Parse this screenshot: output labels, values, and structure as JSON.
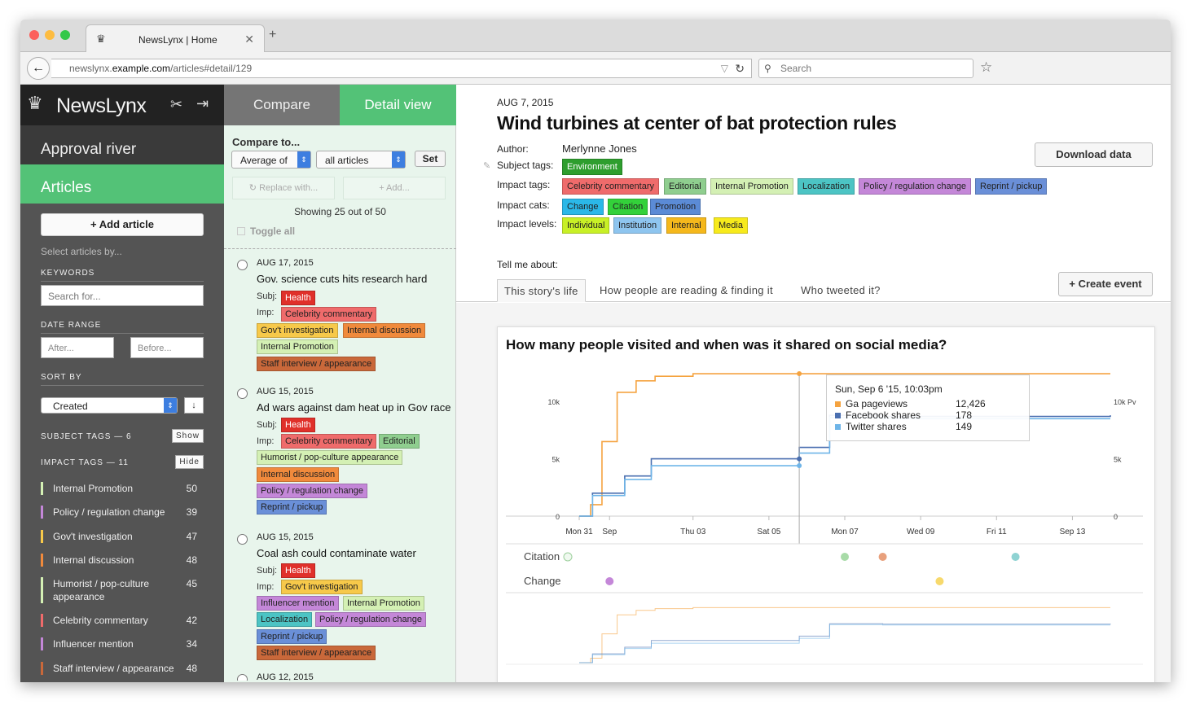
{
  "browser": {
    "tab_title": "NewsLynx | Home",
    "url_prefix": "newslynx.",
    "url_host": "example.com",
    "url_path": "/articles#detail/129",
    "search_placeholder": "Search"
  },
  "sidebar": {
    "brand": "NewsLynx",
    "approval_river": "Approval river",
    "articles": "Articles",
    "add_article": "+ Add article",
    "select_by": "Select articles by...",
    "keywords_label": "KEYWORDS",
    "search_placeholder": "Search for...",
    "date_range_label": "DATE RANGE",
    "after_placeholder": "After...",
    "before_placeholder": "Before...",
    "sort_by_label": "SORT BY",
    "sort_value": "Created",
    "subject_tags_header": "SUBJECT TAGS — 6",
    "subject_tags_btn": "Show",
    "impact_tags_header": "IMPACT TAGS — 11",
    "impact_tags_btn": "Hide",
    "impact_tags": [
      {
        "label": "Internal Promotion",
        "count": "50",
        "color": "#d4f0b4"
      },
      {
        "label": "Policy / regulation change",
        "count": "39",
        "color": "#c487d8"
      },
      {
        "label": "Gov't investigation",
        "count": "47",
        "color": "#f7c94a"
      },
      {
        "label": "Internal discussion",
        "count": "48",
        "color": "#f08a3c"
      },
      {
        "label": "Humorist / pop-culture appearance",
        "count": "45",
        "color": "#d4f0b4"
      },
      {
        "label": "Celebrity commentary",
        "count": "42",
        "color": "#ef6b6b"
      },
      {
        "label": "Influencer mention",
        "count": "34",
        "color": "#c487d8"
      },
      {
        "label": "Staff interview / appearance",
        "count": "48",
        "color": "#c9683a"
      }
    ]
  },
  "mid": {
    "tab_compare": "Compare",
    "tab_detail": "Detail view",
    "compare_to": "Compare to...",
    "select_avg": "Average of",
    "select_all": "all articles",
    "set": "Set",
    "replace_with": "Replace with...",
    "add": "+ Add...",
    "showing": "Showing 25 out of 50",
    "toggle_all": "Toggle all",
    "subj_label": "Subj:",
    "imp_label": "Imp:",
    "articles": [
      {
        "date": "AUG 17, 2015",
        "title": "Gov. science cuts hits research hard",
        "subj": [
          {
            "label": "Health",
            "color": "#e0302a",
            "fg": "#fff"
          }
        ],
        "imp": [
          {
            "label": "Celebrity commentary",
            "color": "#ef6b6b",
            "fg": "#222"
          },
          {
            "label": "Gov't investigation",
            "color": "#f7c94a",
            "fg": "#222"
          },
          {
            "label": "Internal discussion",
            "color": "#f08a3c",
            "fg": "#222"
          },
          {
            "label": "Internal Promotion",
            "color": "#d4f0b4",
            "fg": "#222"
          },
          {
            "label": "Staff interview / appearance",
            "color": "#c9683a",
            "fg": "#222"
          }
        ]
      },
      {
        "date": "AUG 15, 2015",
        "title": "Ad wars against dam heat up in Gov race",
        "subj": [
          {
            "label": "Health",
            "color": "#e0302a",
            "fg": "#fff"
          }
        ],
        "imp": [
          {
            "label": "Celebrity commentary",
            "color": "#ef6b6b",
            "fg": "#222"
          },
          {
            "label": "Editorial",
            "color": "#8fce8f",
            "fg": "#222"
          },
          {
            "label": "Humorist / pop-culture appearance",
            "color": "#d4f0b4",
            "fg": "#222"
          },
          {
            "label": "Internal discussion",
            "color": "#f08a3c",
            "fg": "#222"
          },
          {
            "label": "Policy / regulation change",
            "color": "#c487d8",
            "fg": "#222"
          },
          {
            "label": "Reprint / pickup",
            "color": "#6a8fd8",
            "fg": "#222"
          }
        ]
      },
      {
        "date": "AUG 15, 2015",
        "title": "Coal ash could contaminate water",
        "subj": [
          {
            "label": "Health",
            "color": "#e0302a",
            "fg": "#fff"
          }
        ],
        "imp": [
          {
            "label": "Gov't investigation",
            "color": "#f7c94a",
            "fg": "#222"
          },
          {
            "label": "Influencer mention",
            "color": "#c487d8",
            "fg": "#222"
          },
          {
            "label": "Internal Promotion",
            "color": "#d4f0b4",
            "fg": "#222"
          },
          {
            "label": "Localization",
            "color": "#4cc4c4",
            "fg": "#222"
          },
          {
            "label": "Policy / regulation change",
            "color": "#c487d8",
            "fg": "#222"
          },
          {
            "label": "Reprint / pickup",
            "color": "#6a8fd8",
            "fg": "#222"
          },
          {
            "label": "Staff interview / appearance",
            "color": "#c9683a",
            "fg": "#222"
          }
        ]
      },
      {
        "date": "AUG 12, 2015",
        "title": "",
        "subj": [],
        "imp": []
      }
    ]
  },
  "detail": {
    "date": "AUG 7, 2015",
    "title": "Wind turbines at center of bat protection rules",
    "author_label": "Author:",
    "author": "Merlynne Jones",
    "subject_tags_label": "Subject tags:",
    "subject_tags": [
      {
        "label": "Environment",
        "color": "#2e9e2e",
        "fg": "#fff"
      }
    ],
    "impact_tags_label": "Impact tags:",
    "impact_tags": [
      {
        "label": "Celebrity commentary",
        "color": "#ef6b6b",
        "fg": "#222"
      },
      {
        "label": "Editorial",
        "color": "#8fce8f",
        "fg": "#222"
      },
      {
        "label": "Internal Promotion",
        "color": "#d4f0b4",
        "fg": "#222"
      },
      {
        "label": "Localization",
        "color": "#4cc4c4",
        "fg": "#222"
      },
      {
        "label": "Policy / regulation change",
        "color": "#c487d8",
        "fg": "#222"
      },
      {
        "label": "Reprint / pickup",
        "color": "#6a8fd8",
        "fg": "#222"
      }
    ],
    "impact_cats_label": "Impact cats:",
    "impact_cats": [
      {
        "label": "Change",
        "color": "#2bb8e8",
        "fg": "#222"
      },
      {
        "label": "Citation",
        "color": "#33d13a",
        "fg": "#222"
      },
      {
        "label": "Promotion",
        "color": "#5b8bd6",
        "fg": "#222"
      }
    ],
    "impact_levels_label": "Impact levels:",
    "impact_levels": [
      {
        "label": "Individual",
        "color": "#c8f026",
        "fg": "#222"
      },
      {
        "label": "Institution",
        "color": "#8ec5ef",
        "fg": "#222"
      },
      {
        "label": "Internal",
        "color": "#f5b81c",
        "fg": "#222"
      },
      {
        "label": "Media",
        "color": "#f7ea1c",
        "fg": "#222"
      }
    ],
    "download_data": "Download data",
    "tell_me_about": "Tell me about:",
    "tabs": [
      "This story's life",
      "How people are reading & finding it",
      "Who tweeted it?"
    ],
    "create_event": "+ Create event"
  },
  "chart_data": {
    "type": "line",
    "title": "How many people visited and when was it shared on social media?",
    "x_ticks": [
      "Mon 31",
      "Sep",
      "Thu 03",
      "Sat 05",
      "Mon 07",
      "Wed 09",
      "Fri 11",
      "Sep 13"
    ],
    "y_left_ticks": [
      "0",
      "5k",
      "10k"
    ],
    "y_right_ticks": [
      "0",
      "5k",
      "10k Pv"
    ],
    "ylim": [
      0,
      12500
    ],
    "series": [
      {
        "name": "Ga pageviews",
        "color": "#f5a340",
        "x": [
          0,
          0.3,
          0.6,
          1.0,
          1.5,
          2.0,
          3.0,
          4.0,
          14.0
        ],
        "values": [
          0,
          1000,
          6500,
          10800,
          11800,
          12200,
          12426,
          12426,
          12426
        ]
      },
      {
        "name": "Facebook shares",
        "color": "#4a6fb0",
        "x": [
          0,
          0.35,
          1.2,
          1.9,
          3.0,
          5.8,
          6.6,
          8.0,
          14.0
        ],
        "values": [
          0,
          2000,
          3500,
          5000,
          5000,
          6000,
          8800,
          8700,
          8800
        ]
      },
      {
        "name": "Twitter shares",
        "color": "#6fb5e8",
        "x": [
          0,
          0.35,
          1.2,
          1.9,
          3.0,
          5.8,
          6.6,
          8.0,
          14.0
        ],
        "values": [
          0,
          1800,
          3200,
          4400,
          4400,
          5500,
          8600,
          8500,
          8500
        ]
      }
    ],
    "tooltip": {
      "title": "Sun, Sep 6 '15, 10:03pm",
      "rows": [
        {
          "name": "Ga pageviews",
          "value": "12,426",
          "color": "#f5a340"
        },
        {
          "name": "Facebook shares",
          "value": "178",
          "color": "#4a6fb0"
        },
        {
          "name": "Twitter shares",
          "value": "149",
          "color": "#6fb5e8"
        }
      ]
    },
    "events": [
      {
        "category": "Citation",
        "x": 0,
        "color": "#b6e2b6"
      },
      {
        "category": "Citation",
        "x": 7.0,
        "color": "#a8dba8"
      },
      {
        "category": "Citation",
        "x": 8.0,
        "color": "#e8a07c"
      },
      {
        "category": "Citation",
        "x": 11.5,
        "color": "#8fd3d3"
      },
      {
        "category": "Change",
        "x": 0.8,
        "color": "#c487d8"
      },
      {
        "category": "Change",
        "x": 9.5,
        "color": "#f7d96c"
      }
    ],
    "event_rows": [
      "Citation",
      "Change"
    ]
  }
}
